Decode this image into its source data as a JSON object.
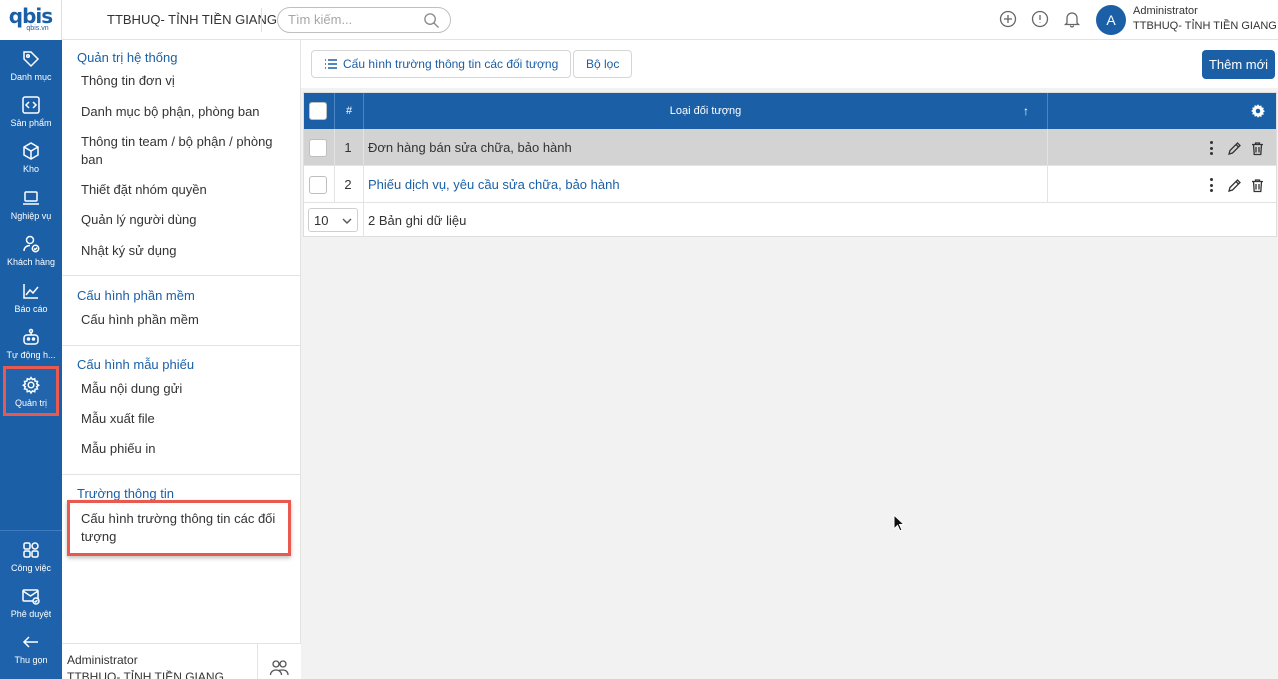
{
  "brand": {
    "logo_text": "qbis",
    "logo_sub": "qbis.vn"
  },
  "header": {
    "org_title": "TTBHUQ- TỈNH TIỀN GIANG",
    "search_placeholder": "Tìm kiếm...",
    "user_initial": "A",
    "user_name": "Administrator",
    "user_org": "TTBHUQ- TỈNH TIỀN GIANG"
  },
  "rail": {
    "items": [
      {
        "label": "Danh mục",
        "icon": "tag-icon"
      },
      {
        "label": "Sản phẩm",
        "icon": "code-box-icon"
      },
      {
        "label": "Kho",
        "icon": "cube-icon"
      },
      {
        "label": "Nghiệp vụ",
        "icon": "laptop-icon"
      },
      {
        "label": "Khách hàng",
        "icon": "user-check-icon"
      },
      {
        "label": "Báo cáo",
        "icon": "line-chart-icon"
      },
      {
        "label": "Tự động h...",
        "icon": "robot-icon"
      },
      {
        "label": "Quản trị",
        "icon": "gear-icon"
      }
    ],
    "bottom_items": [
      {
        "label": "Công việc",
        "icon": "grid-icon"
      },
      {
        "label": "Phê duyệt",
        "icon": "mail-check-icon"
      },
      {
        "label": "Thu gọn",
        "icon": "arrow-left-icon"
      }
    ]
  },
  "submenu": {
    "groups": [
      {
        "title": "Quản trị hệ thống",
        "items": [
          "Thông tin đơn vị",
          "Danh mục bộ phận, phòng ban",
          "Thông tin team / bộ phận / phòng ban",
          "Thiết đặt nhóm quyền",
          "Quản lý người dùng",
          "Nhật ký sử dụng"
        ]
      },
      {
        "title": "Cấu hình phần mềm",
        "items": [
          "Cấu hình phần mềm"
        ]
      },
      {
        "title": "Cấu hình mẫu phiếu",
        "items": [
          "Mẫu nội dung gửi",
          "Mẫu xuất file",
          "Mẫu phiếu in"
        ]
      },
      {
        "title": "Trường thông tin",
        "items": [
          "Cấu hình trường thông tin các đối tượng"
        ]
      }
    ],
    "footer": {
      "name": "Administrator",
      "org": "TTBHUQ- TỈNH TIỀN GIANG"
    }
  },
  "toolbar": {
    "config_label": "Cấu hình trường thông tin các đối tượng",
    "filter_label": "Bộ lọc",
    "add_label": "Thêm mới"
  },
  "grid": {
    "columns": {
      "num": "#",
      "type": "Loại đối tượng",
      "sort_icon": "↑"
    },
    "rows": [
      {
        "num": "1",
        "name": "Đơn hàng bán sửa chữa, bảo hành"
      },
      {
        "num": "2",
        "name": "Phiếu dịch vụ, yêu cầu sửa chữa, bảo hành"
      }
    ],
    "page_size": "10",
    "record_count": "2 Bản ghi dữ liệu"
  },
  "colors": {
    "brand": "#1b5fa6",
    "highlight": "#e85a4f"
  }
}
